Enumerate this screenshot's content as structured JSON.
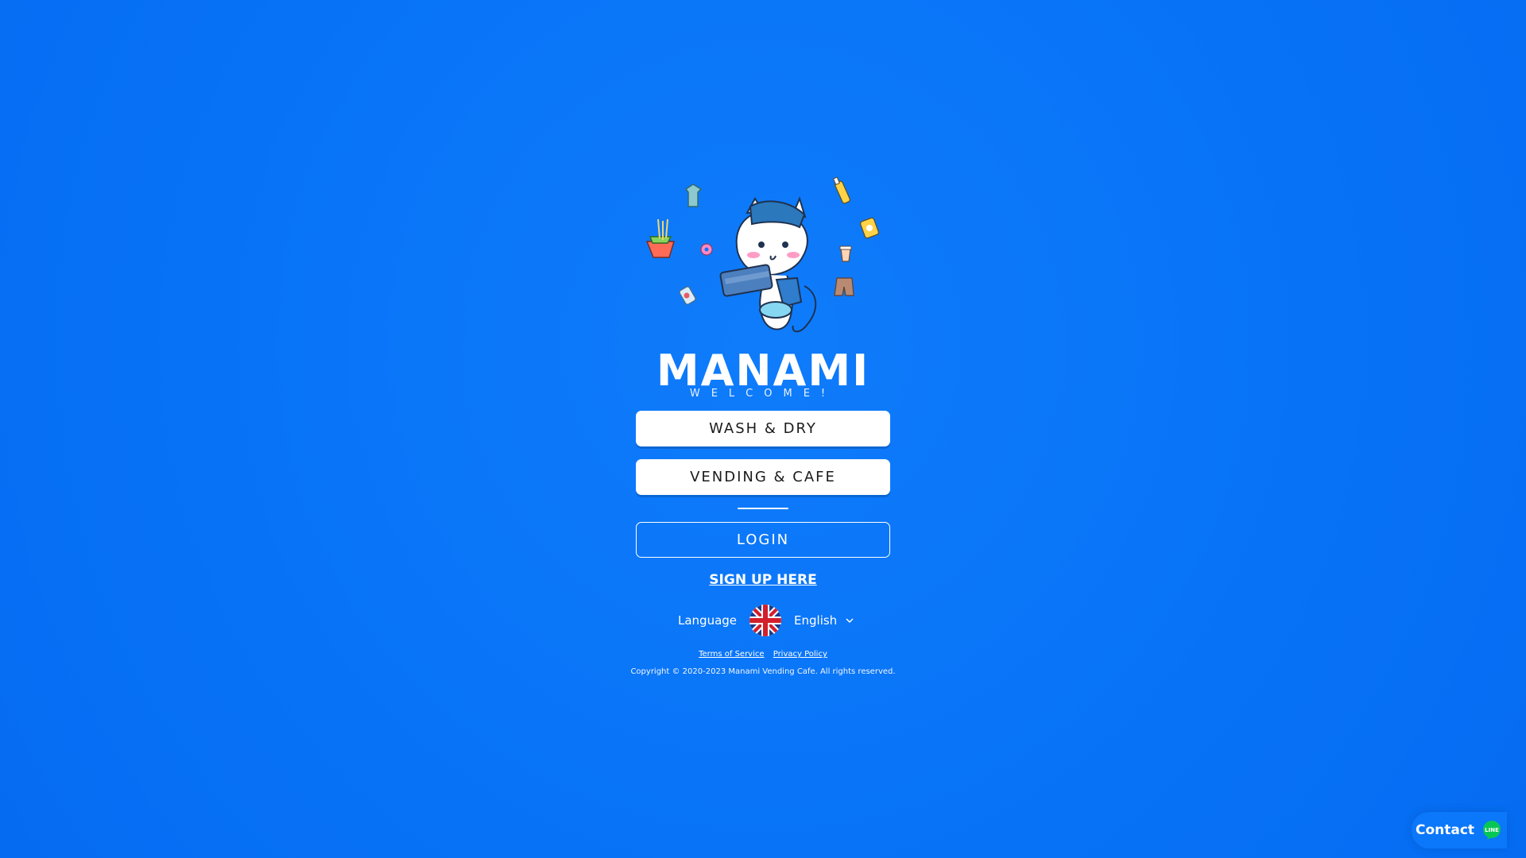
{
  "brand": {
    "logo_text": "MANAMI",
    "welcome_text": "WELCOME!"
  },
  "buttons": {
    "wash_dry": "WASH & DRY",
    "vending_cafe": "VENDING & CAFE",
    "login": "LOGIN",
    "signup": "SIGN UP HERE"
  },
  "language": {
    "label": "Language",
    "selected": "English",
    "flag_icon": "uk-flag-icon"
  },
  "footer": {
    "terms": "Terms of Service",
    "privacy": "Privacy Policy",
    "copyright": "Copyright © 2020-2023 Manami Vending Cafe. All rights reserved."
  },
  "contact": {
    "label": "Contact",
    "icon": "line-chat-icon"
  },
  "colors": {
    "background": "#0a74f7",
    "button_bg": "#ffffff",
    "button_text": "#1b1b1b",
    "line_green": "#06c755"
  }
}
